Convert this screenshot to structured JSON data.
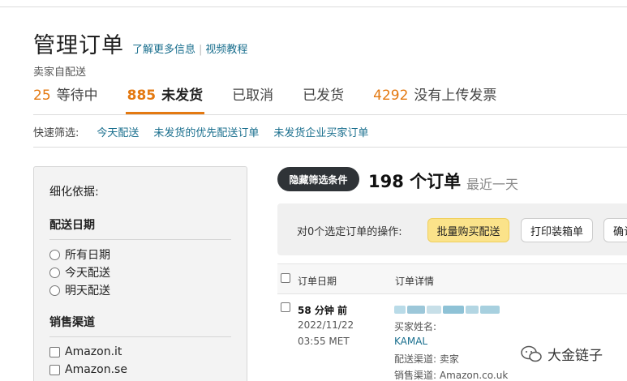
{
  "header": {
    "title": "管理订单",
    "link_more": "了解更多信息",
    "link_video": "视频教程",
    "separator": "|"
  },
  "subtitle": "卖家自配送",
  "tabs": [
    {
      "count": "25",
      "label": "等待中"
    },
    {
      "count": "885",
      "label": "未发货"
    },
    {
      "count": "",
      "label": "已取消"
    },
    {
      "count": "",
      "label": "已发货"
    },
    {
      "count": "4292",
      "label": "没有上传发票"
    }
  ],
  "filters": {
    "label": "快速筛选:",
    "items": [
      "今天配送",
      "未发货的优先配送订单",
      "未发货企业买家订单"
    ]
  },
  "sidebar": {
    "heading": "细化依据:",
    "ship_date": {
      "title": "配送日期",
      "options": [
        "所有日期",
        "今天配送",
        "明天配送"
      ]
    },
    "sales_channel": {
      "title": "销售渠道",
      "options": [
        "Amazon.it",
        "Amazon.se"
      ]
    }
  },
  "summary": {
    "hide_button": "隐藏筛选条件",
    "order_count": "198 个订单",
    "range": "最近一天"
  },
  "actions": {
    "label": "对0个选定订单的操作:",
    "buy_shipping": "批量购买配送",
    "print_packing": "打印装箱单",
    "confirm": "确认"
  },
  "table": {
    "col_date": "订单日期",
    "col_details": "订单详情"
  },
  "order": {
    "time_ago": "58 分钟 前",
    "date": "2022/11/22",
    "time": "03:55 MET",
    "buyer_label": "买家姓名:",
    "buyer_name": "KAMAL",
    "fulfillment": "配送渠道: 卖家",
    "channel": "销售渠道: Amazon.co.uk"
  },
  "watermark": "大金链子",
  "colors": {
    "accent_orange": "#e47911",
    "link_teal": "#1a6f8e",
    "yellow_button": "#fbe38a",
    "dark_pill": "#2f3337"
  }
}
